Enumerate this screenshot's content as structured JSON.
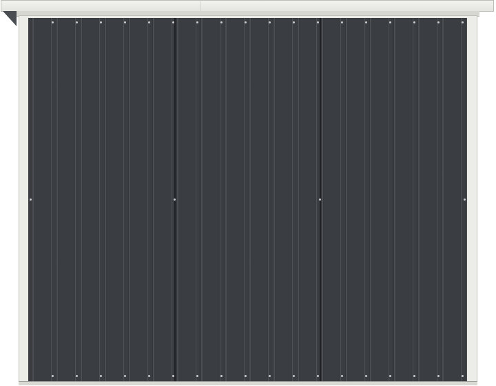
{
  "scene": {
    "subject": "",
    "colors": {
      "wall": "#3a3d41",
      "rib": "#55595e",
      "frame": "#ecece8",
      "roof": "#e4e4e0"
    },
    "rib_count": 18,
    "panel_sections": 3
  }
}
